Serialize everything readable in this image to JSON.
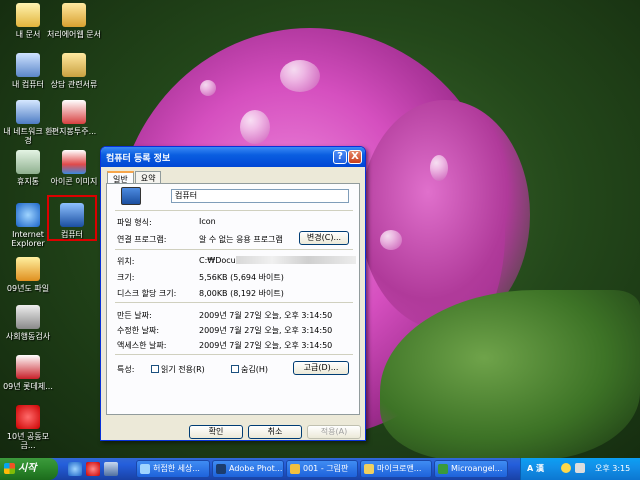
{
  "desktop": {
    "icons": [
      {
        "label": "내 문서"
      },
      {
        "label": "처리에어웹 문서"
      },
      {
        "label": "내 컴퓨터"
      },
      {
        "label": "상담 관련서류"
      },
      {
        "label": "내 네트워크 환경"
      },
      {
        "label": "편지봉투주..."
      },
      {
        "label": "휴지통"
      },
      {
        "label": "아이콘 이미지"
      },
      {
        "label": "Internet Explorer"
      },
      {
        "label": "컴퓨터"
      },
      {
        "label": "09년도 파일"
      },
      {
        "label": "사회행동검사"
      },
      {
        "label": "09년 롯데제..."
      },
      {
        "label": "10년 공동모금..."
      }
    ]
  },
  "dialog": {
    "title": "컴퓨터 등록 정보",
    "help_label": "?",
    "close_label": "X",
    "tabs": [
      "일반",
      "요약"
    ],
    "name_value": "컴퓨터",
    "fields": {
      "type_label": "파일 형식:",
      "type_value": "Icon",
      "open_label": "연결 프로그램:",
      "open_value": "알 수 없는 응용 프로그램",
      "change_button": "변경(C)...",
      "location_label": "위치:",
      "location_value": "C:₩Docu",
      "size_label": "크기:",
      "size_value": "5,56KB (5,694 바이트)",
      "disk_label": "디스크 할당 크기:",
      "disk_value": "8,00KB (8,192 바이트)",
      "created_label": "만든 날짜:",
      "created_value": "2009년 7월 27일 오늘, 오후 3:14:50",
      "modified_label": "수정한 날짜:",
      "modified_value": "2009년 7월 27일 오늘, 오후 3:14:50",
      "accessed_label": "액세스한 날짜:",
      "accessed_value": "2009년 7월 27일 오늘, 오후 3:14:50",
      "attr_label": "특성:",
      "readonly_label": "읽기 전용(R)",
      "hidden_label": "숨김(H)",
      "advanced_button": "고급(D)..."
    },
    "buttons": {
      "ok": "확인",
      "cancel": "취소",
      "apply": "적용(A)"
    }
  },
  "taskbar": {
    "start_label": "시작",
    "tasks": [
      "허접한 세상...",
      "Adobe Phot...",
      "001 - 그림판",
      "마이크로앤...",
      "Microangel..."
    ],
    "tray_ime": "A 漢",
    "clock": "오후 3:15"
  }
}
